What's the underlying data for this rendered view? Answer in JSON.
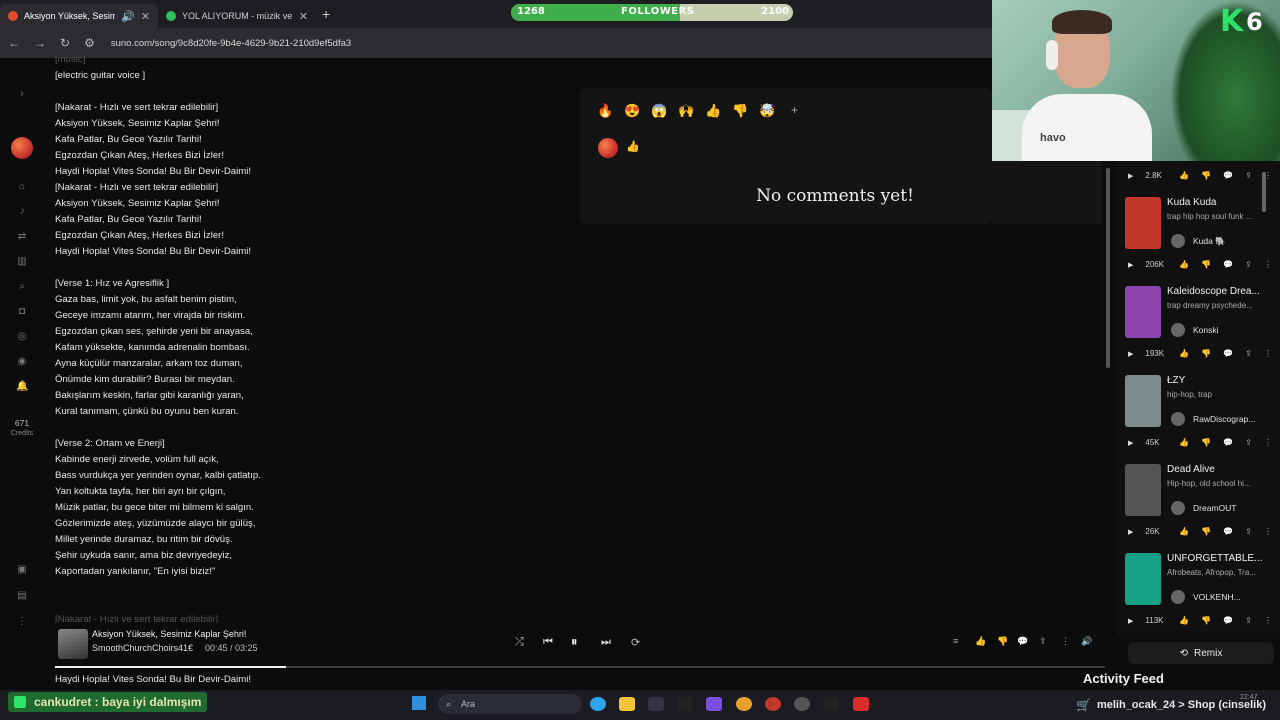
{
  "tabs": [
    {
      "title": "Aksiyon Yüksek, Sesimiz Ka...",
      "active": true
    },
    {
      "title": "YOL ALIYORUM - müzik ve şark...",
      "active": false
    }
  ],
  "followers": {
    "current": "1268",
    "label": "FOLLOWERS",
    "goal": "2100",
    "progress": 0.6
  },
  "address": {
    "url": "suno.com/song/9c8d20fe-9b4e-4629-9b21-210d9ef5dfa3"
  },
  "sidebar": {
    "credits_value": "671",
    "credits_label": "Credits"
  },
  "lyrics": {
    "lines": [
      {
        "text": "[music]",
        "faded": true
      },
      {
        "text": "[electric guitar voice ]"
      },
      {
        "gap": true
      },
      {
        "text": "[Nakarat - Hızlı ve sert tekrar edilebilir]"
      },
      {
        "text": "Aksiyon Yüksek, Sesimiz Kaplar Şehri!"
      },
      {
        "text": "Kafa Patlar, Bu Gece Yazılır Tarihi!"
      },
      {
        "text": "Egzozdan Çıkan Ateş, Herkes Bizi İzler!"
      },
      {
        "text": "Haydi Hopla! Vites Sonda! Bu Bir Devir-Daimi!"
      },
      {
        "text": "[Nakarat - Hızlı ve sert tekrar edilebilir]"
      },
      {
        "text": "Aksiyon Yüksek, Sesimiz Kaplar Şehri!"
      },
      {
        "text": "Kafa Patlar, Bu Gece Yazılır Tarihi!"
      },
      {
        "text": "Egzozdan Çıkan Ateş, Herkes Bizi İzler!"
      },
      {
        "text": "Haydi Hopla! Vites Sonda! Bu Bir Devir-Daimi!"
      },
      {
        "gap": true
      },
      {
        "text": "[Verse 1: Hız ve Agresiflik ]"
      },
      {
        "text": "Gaza bas, limit yok, bu asfalt benim pistim,"
      },
      {
        "text": "Geceye imzamı atarım, her virajda bir riskim."
      },
      {
        "text": "Egzozdan çıkan ses, şehirde yeni bir anayasa,"
      },
      {
        "text": "Kafam yüksekte, kanımda adrenalin bombası."
      },
      {
        "text": "Ayna küçülür manzaralar, arkam toz duman,"
      },
      {
        "text": "Önümde kim durabilir? Burası bir meydan."
      },
      {
        "text": "Bakışlarım keskin, farlar gibi karanlığı yaran,"
      },
      {
        "text": "Kural tanımam, çünkü bu oyunu ben kuran."
      },
      {
        "gap": true
      },
      {
        "text": "[Verse 2: Ortam ve Enerji]"
      },
      {
        "text": "Kabinde enerji zirvede, volüm full açık,"
      },
      {
        "text": "Bass vurdukça yer yerinden oynar, kalbi çatlatıp."
      },
      {
        "text": "Yan koltukta tayfa, her biri ayrı bir çılgın,"
      },
      {
        "text": "Müzik patlar, bu gece biter mi bilmem ki salgın."
      },
      {
        "text": "Gözlerimizde ateş, yüzümüzde alaycı bir gülüş,"
      },
      {
        "text": "Millet yerinde duramaz, bu ritim bir dövüş."
      },
      {
        "text": "Şehir uykuda sanır, ama biz devriyedeyiz,"
      },
      {
        "text": "Kaportadan yankılanır, \"En iyisi biziz!\""
      },
      {
        "gap": true
      },
      {
        "gap": true
      },
      {
        "text": "[Nakarat - Hızlı ve sert tekrar edilebilir]",
        "faded": true
      }
    ],
    "last_line": "Haydi Hopla! Vites Sonda! Bu Bir Devir-Daimi!"
  },
  "comments": {
    "reactions": [
      "🔥",
      "😍",
      "😱",
      "🙌",
      "👍",
      "👎",
      "🤯"
    ],
    "add_label": "+",
    "user_reaction": "👍",
    "empty_text": "No comments yet!"
  },
  "webcam": {
    "brand": "K",
    "brand_number": "6",
    "shirt_text": "havo"
  },
  "feed": {
    "top_stats": {
      "plays": "2.8K"
    },
    "songs": [
      {
        "title": "Kuda Kuda",
        "tags": "trap hip hop soul funk ...",
        "artist": "Kuda 🐘",
        "plays": "206K",
        "cover": "#c0392b"
      },
      {
        "title": "Kaleidoscope Drea...",
        "tags": "trap dreamy psychede...",
        "artist": "Konski",
        "plays": "193K",
        "cover": "#8e44ad"
      },
      {
        "title": "ŁZY",
        "tags": "hip-hop, trap",
        "artist": "RawDiscograp...",
        "plays": "45K",
        "cover": "#7f8c8d"
      },
      {
        "title": "Dead Alive",
        "tags": "Hip-hop, old school hi...",
        "artist": "DreamOUT",
        "plays": "26K",
        "cover": "#555555"
      },
      {
        "title": "UNFORGETTABLE...",
        "tags": "Afrobeats, Afropop, Tra...",
        "artist": "VOLKENH...",
        "plays": "113K",
        "cover": "#16a085"
      }
    ],
    "remix_label": "Remix",
    "activity_label": "Activity Feed"
  },
  "player": {
    "title": "Aksiyon Yüksek, Sesimiz Kaplar Şehri!",
    "artist": "SmoothChurchChoirs41€",
    "time": "00:45 / 03:25",
    "progress": 0.22
  },
  "taskbar": {
    "chat_text": "cankudret : baya iyi dalmışım",
    "search_placeholder": "Ara",
    "mod_text": "melih_ocak_24 > Shop (cinselik)",
    "clock": "22:47"
  }
}
